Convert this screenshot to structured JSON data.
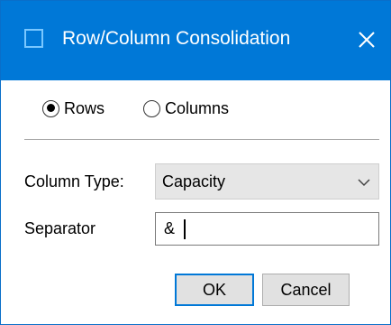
{
  "window": {
    "title": "Row/Column Consolidation",
    "close_icon": "close-icon"
  },
  "consolidate_by": {
    "options": [
      {
        "label": "Rows",
        "selected": true
      },
      {
        "label": "Columns",
        "selected": false
      }
    ]
  },
  "column_type": {
    "label": "Column Type:",
    "value": "Capacity"
  },
  "separator": {
    "label": "Separator",
    "value": "&"
  },
  "buttons": {
    "ok_label": "OK",
    "cancel_label": "Cancel"
  },
  "colors": {
    "titlebar": "#0078d7",
    "accent": "#0078d7"
  }
}
